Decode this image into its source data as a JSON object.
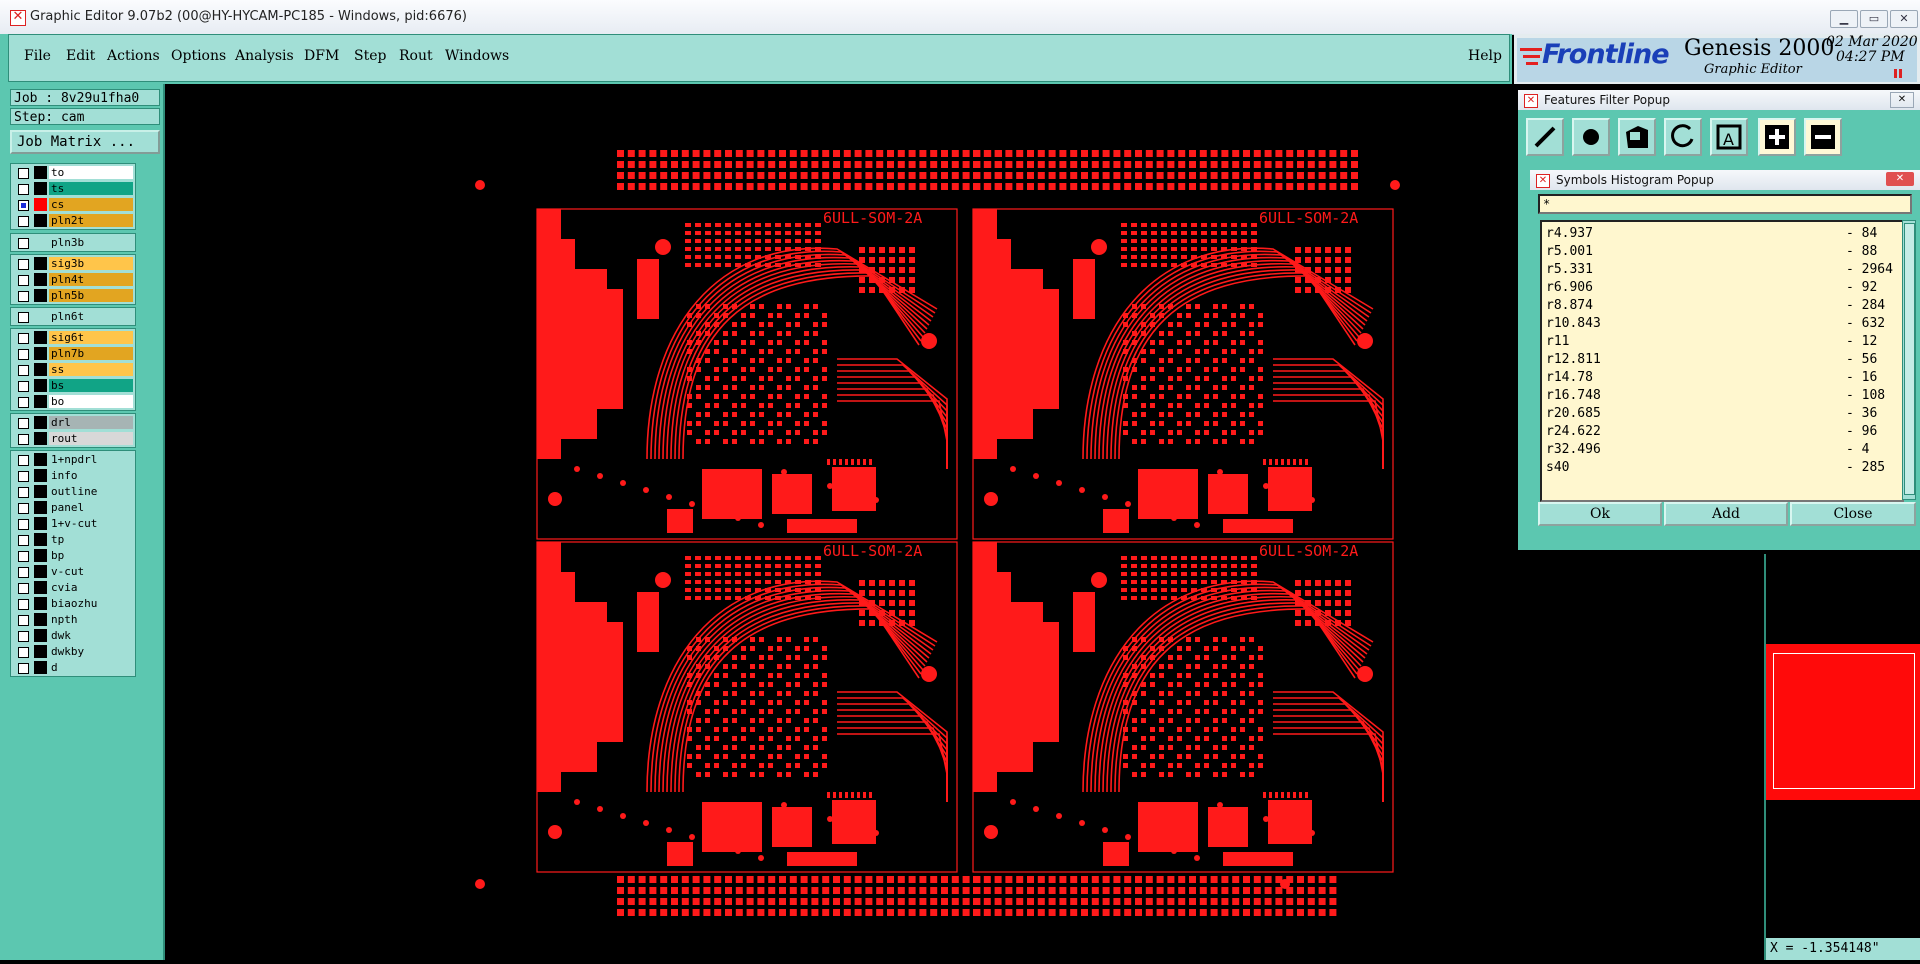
{
  "window": {
    "title": "Graphic Editor 9.07b2 (00@HY-HYCAM-PC185 - Windows, pid:6676)"
  },
  "menu": {
    "items": [
      "File",
      "Edit",
      "Actions",
      "Options",
      "Analysis",
      "DFM",
      "Step",
      "Rout",
      "Windows"
    ],
    "help": "Help"
  },
  "logo": {
    "brand": "Frontline",
    "product": "Genesis 2000",
    "subtitle": "Graphic Editor",
    "date": "02 Mar 2020",
    "time": "04:27 PM"
  },
  "job": {
    "job_label": "Job : 8v29u1fha0",
    "step_label": "Step: cam",
    "matrix_button": "Job Matrix ..."
  },
  "layers": {
    "group1": [
      {
        "name": "to",
        "color": "#ffffff",
        "swatch": "#000000",
        "selected": false
      },
      {
        "name": "ts",
        "color": "#11a486",
        "swatch": "#000000",
        "selected": false
      },
      {
        "name": "cs",
        "color": "#e2a521",
        "swatch": "#ff0000",
        "selected": true
      },
      {
        "name": "pln2t",
        "color": "#e2a521",
        "swatch": "#000000",
        "selected": false
      }
    ],
    "group2": [
      {
        "name": "pln3b",
        "color": "#a2dfd6",
        "swatch": "#a2dfd6",
        "selected": false
      }
    ],
    "group3": [
      {
        "name": "sig3b",
        "color": "#ffc54a",
        "swatch": "#000000",
        "selected": false
      },
      {
        "name": "pln4t",
        "color": "#e2a521",
        "swatch": "#000000",
        "selected": false
      },
      {
        "name": "pln5b",
        "color": "#e2a521",
        "swatch": "#000000",
        "selected": false
      }
    ],
    "group4": [
      {
        "name": "pln6t",
        "color": "#a2dfd6",
        "swatch": "#a2dfd6",
        "selected": false
      }
    ],
    "group5": [
      {
        "name": "sig6t",
        "color": "#ffc54a",
        "swatch": "#000000",
        "selected": false
      },
      {
        "name": "pln7b",
        "color": "#e2a521",
        "swatch": "#000000",
        "selected": false
      },
      {
        "name": "ss",
        "color": "#ffc54a",
        "swatch": "#000000",
        "selected": false
      },
      {
        "name": "bs",
        "color": "#11a486",
        "swatch": "#000000",
        "selected": false
      },
      {
        "name": "bo",
        "color": "#ffffff",
        "swatch": "#000000",
        "selected": false
      }
    ],
    "group6": [
      {
        "name": "drl",
        "color": "#a6b4b4",
        "swatch": "#000000",
        "selected": false
      },
      {
        "name": "rout",
        "color": "#d8d8d8",
        "swatch": "#000000",
        "selected": false
      }
    ],
    "group7": [
      {
        "name": "1+npdrl",
        "color": "#a2dfd6",
        "swatch": "#000000",
        "selected": false
      },
      {
        "name": "info",
        "color": "#a2dfd6",
        "swatch": "#000000",
        "selected": false
      },
      {
        "name": "outline",
        "color": "#a2dfd6",
        "swatch": "#000000",
        "selected": false
      },
      {
        "name": "panel",
        "color": "#a2dfd6",
        "swatch": "#000000",
        "selected": false
      },
      {
        "name": "1+v-cut",
        "color": "#a2dfd6",
        "swatch": "#000000",
        "selected": false
      },
      {
        "name": "tp",
        "color": "#a2dfd6",
        "swatch": "#000000",
        "selected": false
      },
      {
        "name": "bp",
        "color": "#a2dfd6",
        "swatch": "#000000",
        "selected": false
      },
      {
        "name": "v-cut",
        "color": "#a2dfd6",
        "swatch": "#000000",
        "selected": false
      },
      {
        "name": "cvia",
        "color": "#a2dfd6",
        "swatch": "#000000",
        "selected": false
      },
      {
        "name": "biaozhu",
        "color": "#a2dfd6",
        "swatch": "#000000",
        "selected": false
      },
      {
        "name": "npth",
        "color": "#a2dfd6",
        "swatch": "#000000",
        "selected": false
      },
      {
        "name": "dwk",
        "color": "#a2dfd6",
        "swatch": "#000000",
        "selected": false
      },
      {
        "name": "dwkby",
        "color": "#a2dfd6",
        "swatch": "#000000",
        "selected": false
      },
      {
        "name": "d",
        "color": "#a2dfd6",
        "swatch": "#000000",
        "selected": false
      }
    ]
  },
  "board": {
    "label": "6ULL-SOM-2A",
    "trace_color": "#ff1a1a"
  },
  "features_filter": {
    "title": "Features Filter Popup",
    "tools": [
      "line-tool-icon",
      "pad-tool-icon",
      "surface-tool-icon",
      "arc-tool-icon",
      "text-tool-icon",
      "plus-icon",
      "minus-icon"
    ]
  },
  "symbols_histogram": {
    "title": "Symbols Histogram Popup",
    "filter_value": "*",
    "rows": [
      {
        "symbol": "r4.937",
        "count": "- 84"
      },
      {
        "symbol": "r5.001",
        "count": "- 88"
      },
      {
        "symbol": "r5.331",
        "count": "- 2964"
      },
      {
        "symbol": "r6.906",
        "count": "- 92"
      },
      {
        "symbol": "r8.874",
        "count": "- 284"
      },
      {
        "symbol": "r10.843",
        "count": "- 632"
      },
      {
        "symbol": "r11",
        "count": "- 12"
      },
      {
        "symbol": "r12.811",
        "count": "- 56"
      },
      {
        "symbol": "r14.78",
        "count": "- 16"
      },
      {
        "symbol": "r16.748",
        "count": "- 108"
      },
      {
        "symbol": "r20.685",
        "count": "- 36"
      },
      {
        "symbol": "r24.622",
        "count": "- 96"
      },
      {
        "symbol": "r32.496",
        "count": "- 4"
      },
      {
        "symbol": "s40",
        "count": "- 285"
      }
    ],
    "buttons": {
      "ok": "Ok",
      "add": "Add",
      "close": "Close"
    }
  },
  "status": {
    "coordinate": "X = -1.354148\""
  }
}
